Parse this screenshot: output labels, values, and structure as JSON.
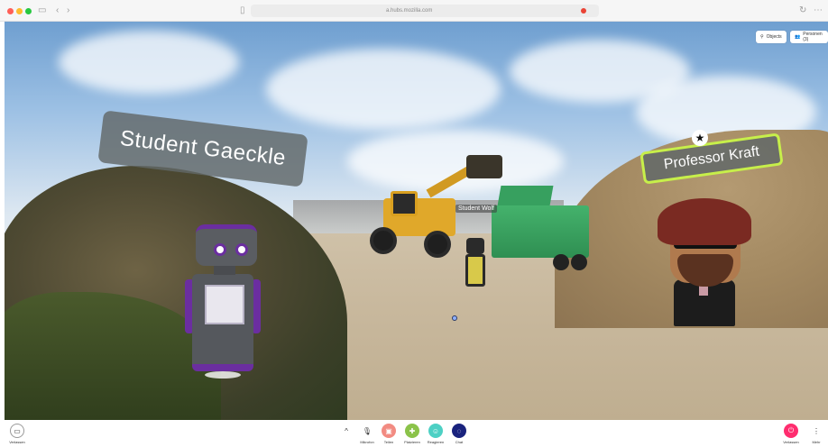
{
  "browser": {
    "url": "a.hubs.mozilla.com",
    "icons": {
      "sidebar": "sidebar-icon",
      "back": "back-icon",
      "forward": "forward-icon",
      "reader": "reader-icon",
      "reload": "reload-icon",
      "share": "share-icon"
    }
  },
  "scene": {
    "name_tags": {
      "gaeckle": "Student Gaeckle",
      "kraft": "Professor Kraft",
      "wolf": "Student Wolf"
    },
    "star": "★",
    "overlay": {
      "objects_label": "Objects",
      "people_label": "Personen (3)"
    }
  },
  "toolbar": {
    "leave_label": "Verlassen",
    "chevron": "^",
    "mic_label": "Mikrofon",
    "share_label": "Teilen",
    "place_label": "Platzieren",
    "react_label": "Reagieren",
    "chat_label": "Chat",
    "end_label": "Verlassen",
    "more_label": "Mehr"
  },
  "colors": {
    "share": "#f28b82",
    "place": "#8bc34a",
    "react": "#4dd0c4",
    "chat": "#1a237e",
    "end": "#ff2d6f",
    "accent_purple": "#6b2ea0",
    "tag_border": "#c7ef4a"
  }
}
